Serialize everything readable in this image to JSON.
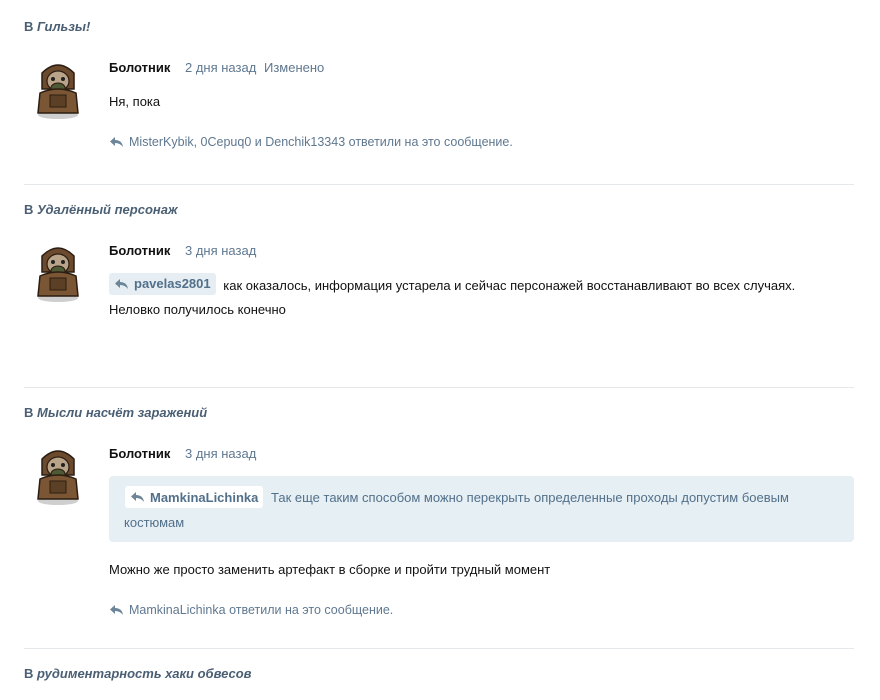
{
  "posts": [
    {
      "topic_prefix": "В",
      "topic_title": "Гильзы!",
      "author": "Болотник",
      "time": "2 дня назад",
      "edited": "Изменено",
      "text": "Ня, пока",
      "replied_names": "MisterKybik, 0Cepuq0",
      "replied_and": "и",
      "replied_last": "Denchik13343",
      "replied_suffix": "ответили на это сообщение."
    },
    {
      "topic_prefix": "В",
      "topic_title": "Удалённый персонаж",
      "author": "Болотник",
      "time": "3 дня назад",
      "mention": "pavelas2801",
      "text_line1": "как оказалось, информация устарела и сейчас персонажей восстанавливают во всех случаях.",
      "text_line2": "Неловко получилось конечно"
    },
    {
      "topic_prefix": "В",
      "topic_title": "Мысли насчёт заражений",
      "author": "Болотник",
      "time": "3 дня назад",
      "quote_author": "MamkinaLichinka",
      "quote_line1": "Так еще таким способом можно перекрыть определенные проходы допустим боевым",
      "quote_line2": "костюмам",
      "text": "Можно же просто заменить артефакт в сборке и пройти трудный момент",
      "replied_names": "MamkinaLichinka",
      "replied_suffix": "ответили на это сообщение."
    },
    {
      "topic_prefix": "В",
      "topic_title": "рудиментарность хаки обвесов"
    }
  ],
  "colors": {
    "topic": "#4a5f73",
    "meta": "#5f7890",
    "quote_bg": "#e6eff4",
    "mention_bg": "#e6eef3"
  }
}
